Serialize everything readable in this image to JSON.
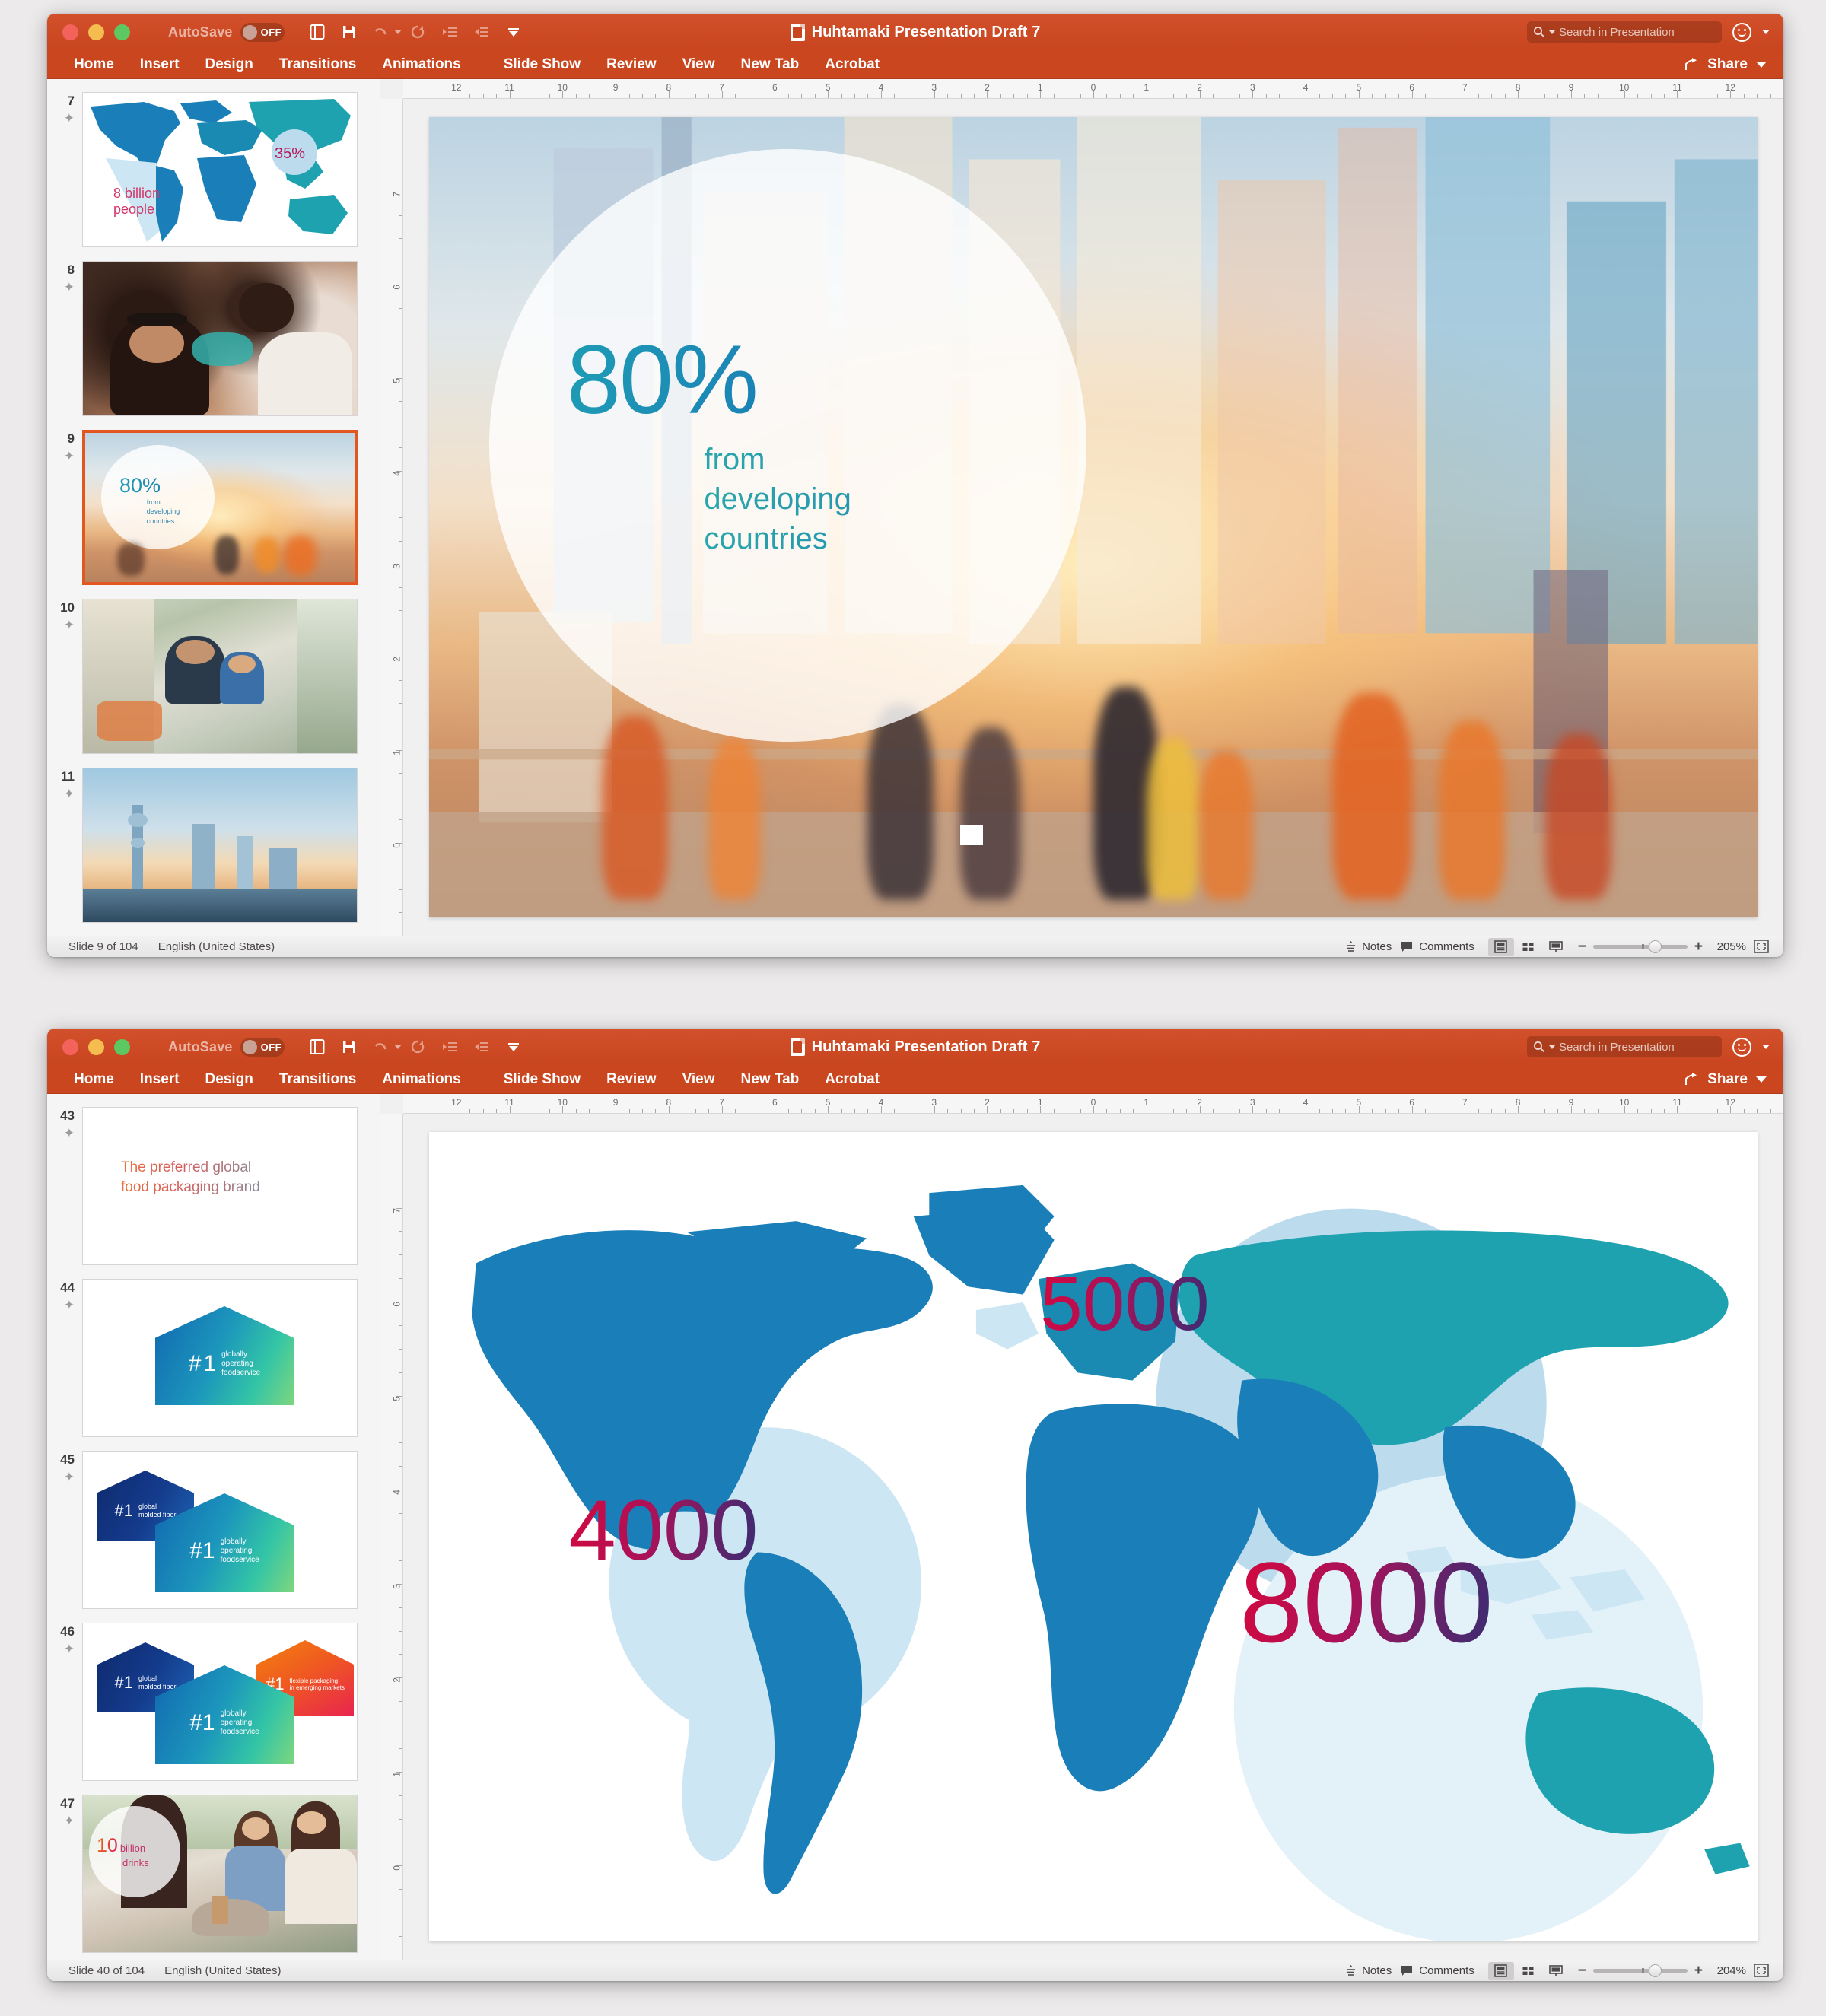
{
  "windows": [
    {
      "id": "win1",
      "title": "Huhtamaki Presentation Draft 7",
      "autosave": {
        "label": "AutoSave",
        "state": "OFF"
      },
      "search_placeholder": "Search in Presentation",
      "share_label": "Share",
      "tabs": [
        "Home",
        "Insert",
        "Design",
        "Transitions",
        "Animations",
        "Slide Show",
        "Review",
        "View",
        "New Tab",
        "Acrobat"
      ],
      "status": {
        "slide_indicator": "Slide 9 of 104",
        "language": "English (United States)",
        "notes_label": "Notes",
        "comments_label": "Comments",
        "zoom_percent": "205%"
      },
      "h_ruler_labels": [
        "12",
        "11",
        "10",
        "9",
        "8",
        "7",
        "6",
        "5",
        "4",
        "3",
        "2",
        "1",
        "0",
        "1",
        "2",
        "3",
        "4",
        "5",
        "6",
        "7",
        "8",
        "9",
        "10",
        "11",
        "12"
      ],
      "v_ruler_labels": [
        "7",
        "6",
        "5",
        "4",
        "3",
        "2",
        "1",
        "0"
      ],
      "thumbnails": [
        {
          "number": "7",
          "type": "worldmap",
          "texts": {
            "pct": "35%",
            "line1": "8 billion",
            "line2": "people"
          }
        },
        {
          "number": "8",
          "type": "photo-women",
          "texts": {}
        },
        {
          "number": "9",
          "type": "city80",
          "selected": true,
          "texts": {
            "big": "80%",
            "l1": "from",
            "l2": "developing",
            "l3": "countries"
          }
        },
        {
          "number": "10",
          "type": "photo-market",
          "texts": {}
        },
        {
          "number": "11",
          "type": "photo-skyline",
          "texts": {}
        }
      ],
      "slide": {
        "kind": "city80",
        "big_number": "80%",
        "line1": "from",
        "line2": "developing",
        "line3": "countries"
      }
    },
    {
      "id": "win2",
      "title": "Huhtamaki Presentation Draft 7",
      "autosave": {
        "label": "AutoSave",
        "state": "OFF"
      },
      "search_placeholder": "Search in Presentation",
      "share_label": "Share",
      "tabs": [
        "Home",
        "Insert",
        "Design",
        "Transitions",
        "Animations",
        "Slide Show",
        "Review",
        "View",
        "New Tab",
        "Acrobat"
      ],
      "status": {
        "slide_indicator": "Slide 40 of 104",
        "language": "English (United States)",
        "notes_label": "Notes",
        "comments_label": "Comments",
        "zoom_percent": "204%"
      },
      "h_ruler_labels": [
        "12",
        "11",
        "10",
        "9",
        "8",
        "7",
        "6",
        "5",
        "4",
        "3",
        "2",
        "1",
        "0",
        "1",
        "2",
        "3",
        "4",
        "5",
        "6",
        "7",
        "8",
        "9",
        "10",
        "11",
        "12"
      ],
      "v_ruler_labels": [
        "7",
        "6",
        "5",
        "4",
        "3",
        "2",
        "1",
        "0"
      ],
      "thumbnails": [
        {
          "number": "43",
          "type": "tagline",
          "texts": {
            "l1": "The preferred global",
            "l2": "food packaging brand"
          }
        },
        {
          "number": "44",
          "type": "pent1",
          "texts": {
            "hash": "#",
            "one": "1",
            "c1": "globally",
            "c2": "operating",
            "c3": "foodservice"
          }
        },
        {
          "number": "45",
          "type": "pent2",
          "texts": {
            "a1": "global",
            "a2": "molded fiber",
            "b1": "globally",
            "b2": "operating",
            "b3": "foodservice"
          }
        },
        {
          "number": "46",
          "type": "pent3",
          "texts": {
            "a1": "global",
            "a2": "molded fiber",
            "b1": "globally",
            "b2": "operating",
            "b3": "foodservice",
            "c1": "flexible packaging",
            "c2": "in emerging markets"
          }
        },
        {
          "number": "47",
          "type": "photo-drinks",
          "texts": {
            "num": "10",
            "w1": "billion",
            "w2": "drinks"
          }
        }
      ],
      "slide": {
        "kind": "map-numbers",
        "numbers": [
          {
            "value": "4000",
            "region": "Americas"
          },
          {
            "value": "5000",
            "region": "Europe"
          },
          {
            "value": "8000",
            "region": "Asia-Pacific"
          }
        ]
      }
    }
  ],
  "colors": {
    "titlebar": "#c8451f",
    "ribbon": "#c9461f",
    "selection": "#e2561f",
    "map_blue": "#1a7fb8",
    "map_teal": "#1fa2b0",
    "map_pale": "#cde6f3",
    "crimson": "#d3083f",
    "purple": "#3a2c72"
  }
}
